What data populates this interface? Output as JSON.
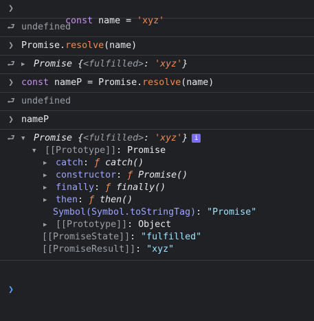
{
  "entries": [
    {
      "input": {
        "keyword": "const",
        "name": "name",
        "op": " = ",
        "value": "'xyz'"
      },
      "output": "undefined"
    },
    {
      "input": {
        "obj": "Promise",
        "dot": ".",
        "method": "resolve",
        "args": "(name)"
      },
      "output": {
        "label": "Promise",
        "open": " {",
        "key": "<fulfilled>",
        "colon": ": ",
        "value": "'xyz'",
        "close": "}"
      }
    },
    {
      "input": {
        "keyword": "const",
        "name": "nameP",
        "op": " = ",
        "obj": "Promise",
        "dot": ".",
        "method": "resolve",
        "args": "(name)"
      },
      "output": "undefined"
    },
    {
      "input": {
        "text": "nameP"
      },
      "output": {
        "label": "Promise",
        "open": " {",
        "key": "<fulfilled>",
        "colon": ": ",
        "value": "'xyz'",
        "close": "}",
        "badge": "i",
        "prototype": {
          "key": "[[Prototype]]",
          "colon": ": ",
          "value": "Promise"
        },
        "members": [
          {
            "key": "catch",
            "colon": ": ",
            "f": "ƒ",
            "sig": "catch()"
          },
          {
            "key": "constructor",
            "colon": ": ",
            "f": "ƒ",
            "sig": "Promise()"
          },
          {
            "key": "finally",
            "colon": ": ",
            "f": "ƒ",
            "sig": "finally()"
          },
          {
            "key": "then",
            "colon": ": ",
            "f": "ƒ",
            "sig": "then()"
          }
        ],
        "symbol": {
          "key": "Symbol(Symbol.toStringTag)",
          "colon": ": ",
          "value": "\"Promise\""
        },
        "proto2": {
          "key": "[[Prototype]]",
          "colon": ": ",
          "value": "Object"
        },
        "state": {
          "key": "[[PromiseState]]",
          "colon": ": ",
          "value": "\"fulfilled\""
        },
        "result": {
          "key": "[[PromiseResult]]",
          "colon": ": ",
          "value": "\"xyz\""
        }
      }
    }
  ],
  "icons": {
    "input": "chevron-right",
    "output": "return-arrow",
    "expand": "triangle"
  },
  "colors": {
    "background": "#202124",
    "keyword": "#c792ea",
    "string": "#f28b54",
    "property": "#9da5ff",
    "value": "#9ee2ff",
    "muted": "#9aa0a6",
    "prompt": "#5aa0ff"
  }
}
